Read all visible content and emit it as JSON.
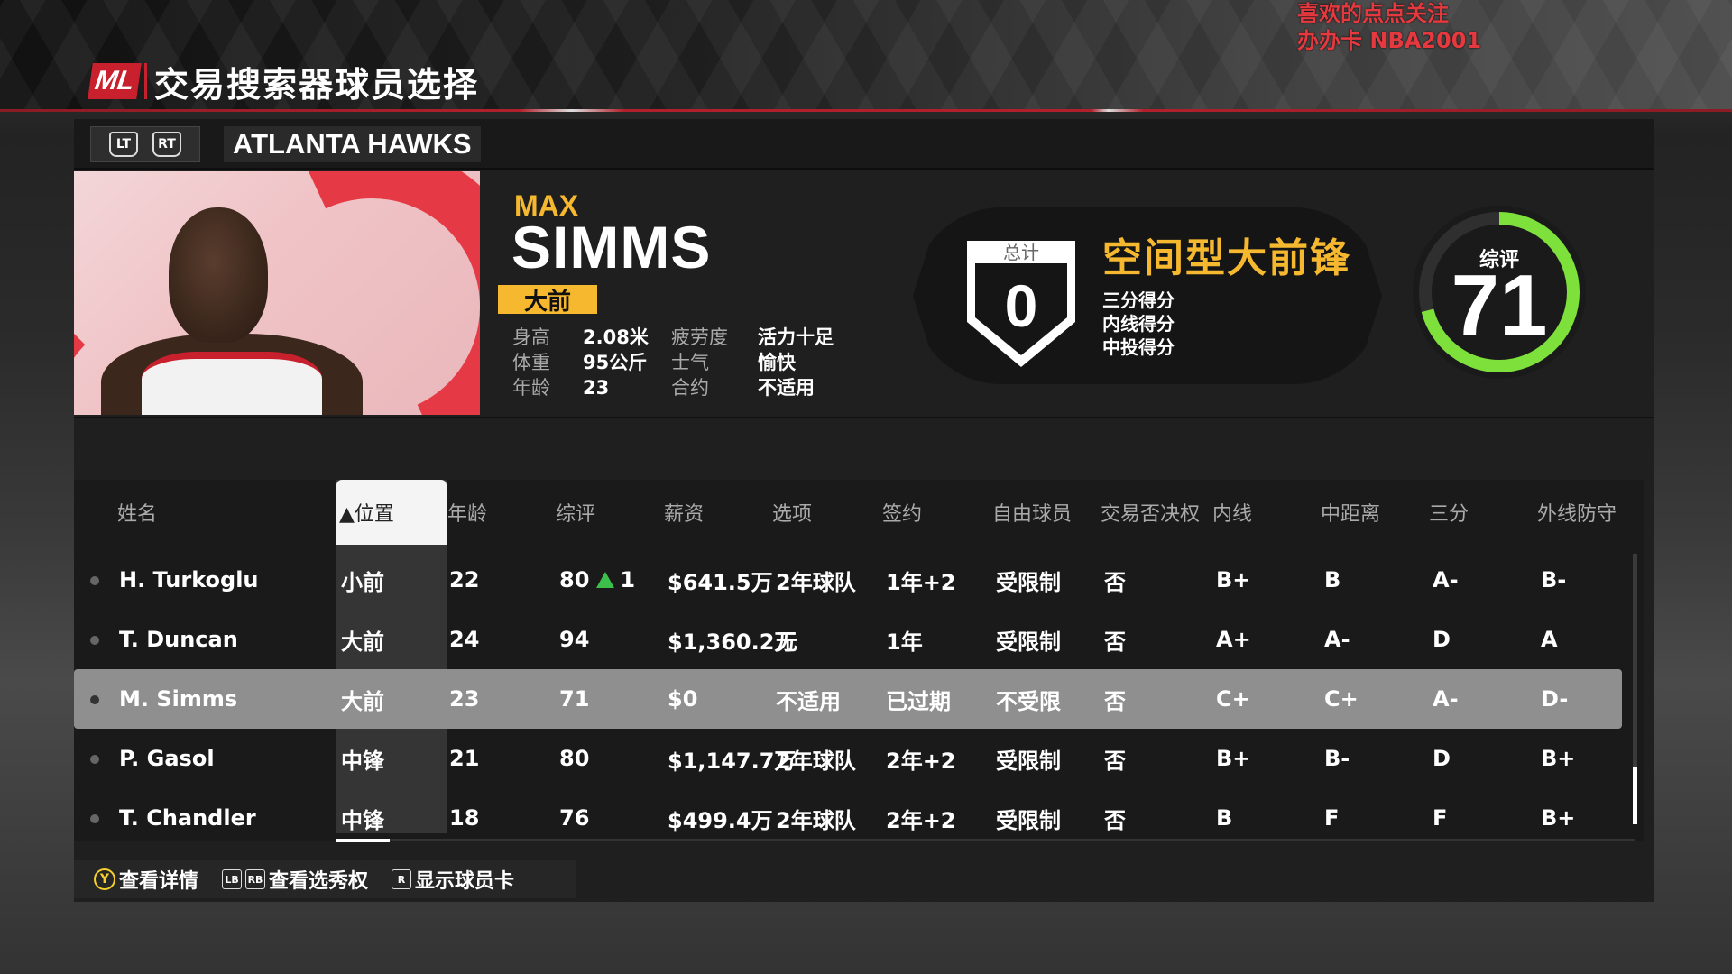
{
  "watermark": {
    "line1": "喜欢的点点关注",
    "line2": "办办卡 NBA2001"
  },
  "header": {
    "logo": "ML",
    "title": "交易搜索器球员选择"
  },
  "team_bar": {
    "lt": "LT",
    "rt": "RT",
    "team_name": "ATLANTA HAWKS"
  },
  "player": {
    "first_name": "MAX",
    "last_name": "SIMMS",
    "position": "大前",
    "attrs": [
      {
        "k1": "身高",
        "v1": "2.08米",
        "k2": "疲劳度",
        "v2": "活力十足"
      },
      {
        "k1": "体重",
        "v1": "95公斤",
        "k2": "士气",
        "v2": "愉快"
      },
      {
        "k1": "年龄",
        "v1": "23",
        "k2": "合约",
        "v2": "不适用"
      }
    ]
  },
  "archetype": {
    "total_label": "总计",
    "total_value": "0",
    "title": "空间型大前锋",
    "tags": [
      "三分得分",
      "内线得分",
      "中投得分"
    ]
  },
  "overall": {
    "label": "综评",
    "value": "71",
    "fraction": 0.71,
    "ring_color": "#7ee03a"
  },
  "table": {
    "headers": [
      "姓名",
      "▲位置",
      "年龄",
      "综评",
      "薪资",
      "选项",
      "签约",
      "自由球员",
      "交易否决权",
      "内线",
      "中距离",
      "三分",
      "外线防守"
    ],
    "rows": [
      {
        "name": "H. Turkoglu",
        "pos": "小前",
        "age": "22",
        "ovr": "80",
        "ovr_change": "1",
        "salary": "$641.5万",
        "option": "2年球队",
        "signed": "1年+2",
        "fa": "受限制",
        "veto": "否",
        "inside": "B+",
        "mid": "B",
        "three": "A-",
        "perim_d": "B-"
      },
      {
        "name": "T. Duncan",
        "pos": "大前",
        "age": "24",
        "ovr": "94",
        "ovr_change": "",
        "salary": "$1,360.2万",
        "option": "无",
        "signed": "1年",
        "fa": "受限制",
        "veto": "否",
        "inside": "A+",
        "mid": "A-",
        "three": "D",
        "perim_d": "A"
      },
      {
        "name": "M. Simms",
        "pos": "大前",
        "age": "23",
        "ovr": "71",
        "ovr_change": "",
        "salary": "$0",
        "option": "不适用",
        "signed": "已过期",
        "fa": "不受限",
        "veto": "否",
        "inside": "C+",
        "mid": "C+",
        "three": "A-",
        "perim_d": "D-"
      },
      {
        "name": "P. Gasol",
        "pos": "中锋",
        "age": "21",
        "ovr": "80",
        "ovr_change": "",
        "salary": "$1,147.7万",
        "option": "2年球队",
        "signed": "2年+2",
        "fa": "受限制",
        "veto": "否",
        "inside": "B+",
        "mid": "B-",
        "three": "D",
        "perim_d": "B+"
      },
      {
        "name": "T. Chandler",
        "pos": "中锋",
        "age": "18",
        "ovr": "76",
        "ovr_change": "",
        "salary": "$499.4万",
        "option": "2年球队",
        "signed": "2年+2",
        "fa": "受限制",
        "veto": "否",
        "inside": "B",
        "mid": "F",
        "three": "F",
        "perim_d": "B+"
      }
    ],
    "selected_index": 2
  },
  "footer": {
    "y_btn": "Y",
    "details": "查看详情",
    "lb": "LB",
    "rb": "RB",
    "picks": "查看选秀权",
    "rt_btn": "R",
    "card": "显示球员卡"
  }
}
